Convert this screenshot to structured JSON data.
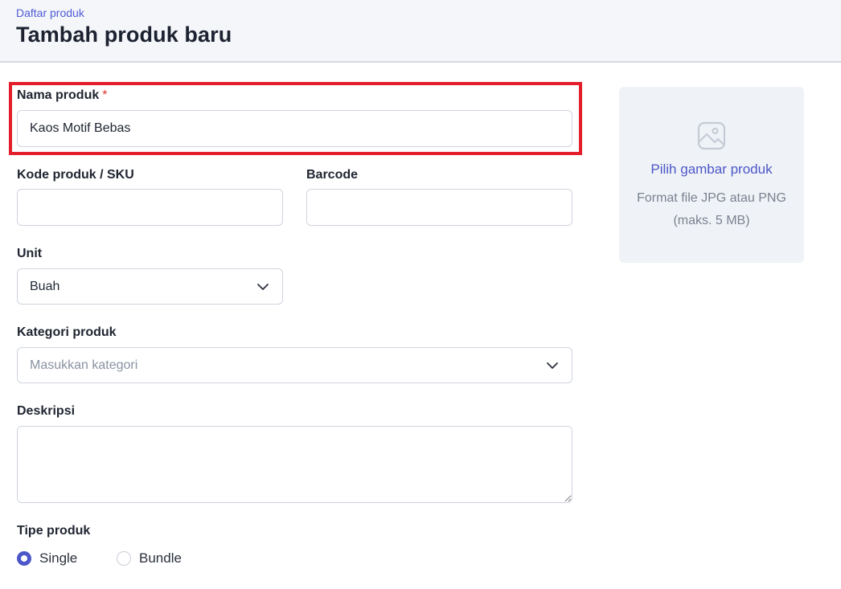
{
  "header": {
    "breadcrumb": "Daftar produk",
    "title": "Tambah produk baru"
  },
  "form": {
    "name": {
      "label": "Nama produk",
      "required_mark": "*",
      "value": "Kaos Motif Bebas"
    },
    "sku": {
      "label": "Kode produk / SKU",
      "value": ""
    },
    "barcode": {
      "label": "Barcode",
      "value": ""
    },
    "unit": {
      "label": "Unit",
      "selected": "Buah"
    },
    "category": {
      "label": "Kategori produk",
      "placeholder": "Masukkan kategori"
    },
    "description": {
      "label": "Deskripsi",
      "value": ""
    },
    "type": {
      "label": "Tipe produk",
      "options": [
        {
          "label": "Single",
          "selected": true
        },
        {
          "label": "Bundle",
          "selected": false
        }
      ]
    }
  },
  "image_panel": {
    "link": "Pilih gambar produk",
    "hint": "Format file JPG atau PNG (maks. 5 MB)",
    "icon": "image-icon"
  },
  "colors": {
    "accent": "#4b57c9",
    "highlight": "#e41d2b",
    "header_bg": "#f4f6fa",
    "required": "#e0342f"
  }
}
